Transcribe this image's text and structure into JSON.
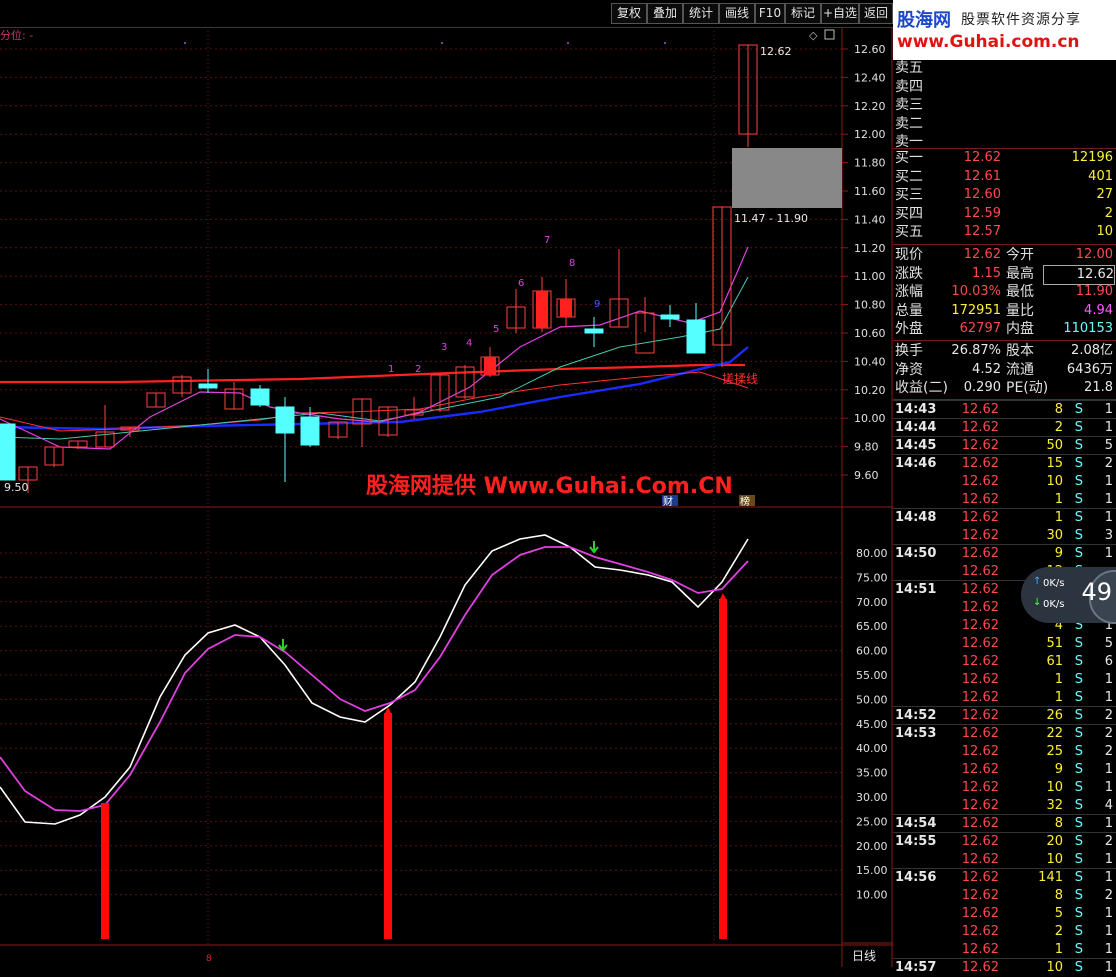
{
  "toolbar": {
    "buttons": [
      "复权",
      "叠加",
      "统计",
      "画线",
      "F10",
      "标记",
      "+自选",
      "返回"
    ]
  },
  "logo": {
    "brand": "股海网",
    "slogan": "股票软件资源分享",
    "url": "www.Guhai.com.cn"
  },
  "main_chart": {
    "indicator_label": "分位: -",
    "price_axis": [
      "12.60",
      "12.40",
      "12.20",
      "12.00",
      "11.80",
      "11.60",
      "11.40",
      "11.20",
      "11.00",
      "10.80",
      "10.60",
      "10.40",
      "10.20",
      "10.00",
      "9.80",
      "9.60"
    ],
    "high_label": "12.62",
    "low_label": "9.50",
    "range_label": "11.47 - 11.90",
    "line_label": "搓揉线",
    "count_labels": [
      "1",
      "2",
      "3",
      "4",
      "5",
      "6",
      "7",
      "8",
      "9"
    ],
    "watermark": "股海网提供 Www.Guhai.Com.CN",
    "badge_cai": "财",
    "badge_bang": "榜"
  },
  "sub_chart": {
    "axis": [
      "80.00",
      "75.00",
      "70.00",
      "65.00",
      "60.00",
      "55.00",
      "50.00",
      "45.00",
      "40.00",
      "35.00",
      "30.00",
      "25.00",
      "20.00",
      "15.00",
      "10.00"
    ],
    "period_label": "日线",
    "bottom_marker": "8"
  },
  "colors": {
    "up": "#ff3b3b",
    "down": "#55ffff",
    "grid": "#8b1a1a",
    "ma_blue": "#1a2bff",
    "ma_red": "#ff2020",
    "k_line": "#ffffff",
    "d_line": "#e040e0"
  },
  "orderbook": {
    "sell": [
      {
        "label": "卖五",
        "price": "",
        "vol": ""
      },
      {
        "label": "卖四",
        "price": "",
        "vol": ""
      },
      {
        "label": "卖三",
        "price": "",
        "vol": ""
      },
      {
        "label": "卖二",
        "price": "",
        "vol": ""
      },
      {
        "label": "卖一",
        "price": "",
        "vol": ""
      }
    ],
    "buy": [
      {
        "label": "买一",
        "price": "12.62",
        "vol": "12196"
      },
      {
        "label": "买二",
        "price": "12.61",
        "vol": "401"
      },
      {
        "label": "买三",
        "price": "12.60",
        "vol": "27"
      },
      {
        "label": "买四",
        "price": "12.59",
        "vol": "2"
      },
      {
        "label": "买五",
        "price": "12.57",
        "vol": "10"
      }
    ]
  },
  "quote": [
    {
      "l1": "现价",
      "v1": "12.62",
      "l2": "今开",
      "v2": "12.00"
    },
    {
      "l1": "涨跌",
      "v1": "1.15",
      "l2": "最高",
      "v2": "12.62"
    },
    {
      "l1": "涨幅",
      "v1": "10.03%",
      "l2": "最低",
      "v2": "11.90"
    },
    {
      "l1": "总量",
      "v1": "172951",
      "l2": "量比",
      "v2": "4.94"
    },
    {
      "l1": "外盘",
      "v1": "62797",
      "l2": "内盘",
      "v2": "110153"
    }
  ],
  "stats": [
    {
      "l1": "换手",
      "v1": "26.87%",
      "l2": "股本",
      "v2": "2.08亿"
    },
    {
      "l1": "净资",
      "v1": "4.52",
      "l2": "流通",
      "v2": "6436万"
    },
    {
      "l1": "收益(二)",
      "v1": "0.290",
      "l2": "PE(动)",
      "v2": "21.8"
    }
  ],
  "ticks": [
    {
      "time": "14:43",
      "price": "12.62",
      "vol": "8",
      "side": "S",
      "n": "1"
    },
    {
      "time": "14:44",
      "price": "12.62",
      "vol": "2",
      "side": "S",
      "n": "1"
    },
    {
      "time": "14:45",
      "price": "12.62",
      "vol": "50",
      "side": "S",
      "n": "5"
    },
    {
      "time": "14:46",
      "price": "12.62",
      "vol": "15",
      "side": "S",
      "n": "2"
    },
    {
      "time": "",
      "price": "12.62",
      "vol": "10",
      "side": "S",
      "n": "1"
    },
    {
      "time": "",
      "price": "12.62",
      "vol": "1",
      "side": "S",
      "n": "1"
    },
    {
      "time": "14:48",
      "price": "12.62",
      "vol": "1",
      "side": "S",
      "n": "1"
    },
    {
      "time": "",
      "price": "12.62",
      "vol": "30",
      "side": "S",
      "n": "3"
    },
    {
      "time": "14:50",
      "price": "12.62",
      "vol": "9",
      "side": "S",
      "n": "1"
    },
    {
      "time": "",
      "price": "12.62",
      "vol": "12",
      "side": "S",
      "n": ""
    },
    {
      "time": "14:51",
      "price": "12.62",
      "vol": "",
      "side": "",
      "n": ""
    },
    {
      "time": "",
      "price": "12.62",
      "vol": "",
      "side": "",
      "n": ""
    },
    {
      "time": "",
      "price": "12.62",
      "vol": "4",
      "side": "S",
      "n": "1"
    },
    {
      "time": "",
      "price": "12.62",
      "vol": "51",
      "side": "S",
      "n": "5"
    },
    {
      "time": "",
      "price": "12.62",
      "vol": "61",
      "side": "S",
      "n": "6"
    },
    {
      "time": "",
      "price": "12.62",
      "vol": "1",
      "side": "S",
      "n": "1"
    },
    {
      "time": "",
      "price": "12.62",
      "vol": "1",
      "side": "S",
      "n": "1"
    },
    {
      "time": "14:52",
      "price": "12.62",
      "vol": "26",
      "side": "S",
      "n": "2"
    },
    {
      "time": "14:53",
      "price": "12.62",
      "vol": "22",
      "side": "S",
      "n": "2"
    },
    {
      "time": "",
      "price": "12.62",
      "vol": "25",
      "side": "S",
      "n": "2"
    },
    {
      "time": "",
      "price": "12.62",
      "vol": "9",
      "side": "S",
      "n": "1"
    },
    {
      "time": "",
      "price": "12.62",
      "vol": "10",
      "side": "S",
      "n": "1"
    },
    {
      "time": "",
      "price": "12.62",
      "vol": "32",
      "side": "S",
      "n": "4"
    },
    {
      "time": "14:54",
      "price": "12.62",
      "vol": "8",
      "side": "S",
      "n": "1"
    },
    {
      "time": "14:55",
      "price": "12.62",
      "vol": "20",
      "side": "S",
      "n": "2"
    },
    {
      "time": "",
      "price": "12.62",
      "vol": "10",
      "side": "S",
      "n": "1"
    },
    {
      "time": "14:56",
      "price": "12.62",
      "vol": "141",
      "side": "S",
      "n": "1"
    },
    {
      "time": "",
      "price": "12.62",
      "vol": "8",
      "side": "S",
      "n": "2"
    },
    {
      "time": "",
      "price": "12.62",
      "vol": "5",
      "side": "S",
      "n": "1"
    },
    {
      "time": "",
      "price": "12.62",
      "vol": "2",
      "side": "S",
      "n": "1"
    },
    {
      "time": "",
      "price": "12.62",
      "vol": "1",
      "side": "S",
      "n": "1"
    },
    {
      "time": "14:57",
      "price": "12.62",
      "vol": "10",
      "side": "S",
      "n": "1"
    }
  ],
  "speed_widget": {
    "up": "0K/s",
    "down": "0K/s",
    "percent": "49"
  }
}
